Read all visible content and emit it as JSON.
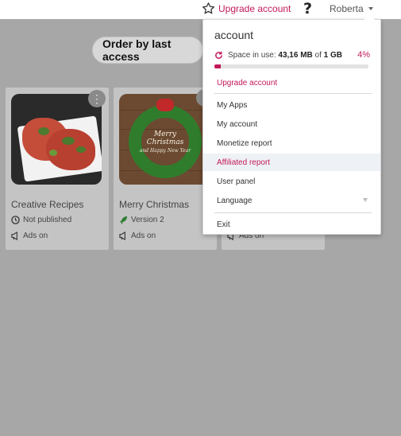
{
  "topbar": {
    "upgrade_label": "Upgrade account",
    "help_symbol": "?",
    "user_name": "Roberta"
  },
  "toolbar": {
    "order_label": "Order by last access"
  },
  "apps": [
    {
      "title": "Creative Recipes",
      "status": "Not published",
      "status_icon": "clock-icon",
      "ads": "Ads on"
    },
    {
      "title": "Merry Christmas",
      "status": "Version 2",
      "status_icon": "rocket-icon",
      "ads": "Ads on"
    },
    {
      "ads": "Ads on"
    }
  ],
  "thumb_text": {
    "wreath_line1": "Merry Christmas",
    "wreath_line2": "and Happy New Year"
  },
  "account_menu": {
    "header": "account",
    "space_label": "Space in use:",
    "space_used": "43,16 MB",
    "space_of": "of",
    "space_total": "1 GB",
    "space_percent_label": "4%",
    "space_fraction": 0.04,
    "items": [
      {
        "label": "Upgrade account",
        "accent": true
      },
      {
        "label": "My Apps"
      },
      {
        "label": "My account"
      },
      {
        "label": "Monetize report"
      },
      {
        "label": "Affiliated report",
        "accent": true,
        "highlighted": true
      },
      {
        "label": "User panel"
      },
      {
        "label": "Language",
        "has_submenu": true
      },
      {
        "label": "Exit"
      }
    ]
  },
  "colors": {
    "accent": "#c2185b",
    "overlay_bg": "#a7a7a7",
    "highlight": "#eef2f6",
    "rocket": "#2e7d32"
  }
}
